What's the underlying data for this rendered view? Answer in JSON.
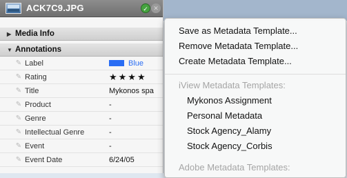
{
  "window": {
    "file_name": "ACK7C9.JPG",
    "thumbnail_icon": "photo-thumbnail"
  },
  "sections": {
    "media_info": "Media Info",
    "annotations": "Annotations"
  },
  "annotations": [
    {
      "field": "Label",
      "value": "Blue",
      "swatch_color": "#2a6df4"
    },
    {
      "field": "Rating",
      "value": "★★★★"
    },
    {
      "field": "Title",
      "value": "Mykonos spa"
    },
    {
      "field": "Product",
      "value": "-"
    },
    {
      "field": "Genre",
      "value": "-"
    },
    {
      "field": "Intellectual Genre",
      "value": "-"
    },
    {
      "field": "Event",
      "value": "-"
    },
    {
      "field": "Event Date",
      "value": "6/24/05"
    }
  ],
  "menu": {
    "save_template": "Save as Metadata Template...",
    "remove_template": "Remove Metadata Template...",
    "create_template": "Create Metadata Template...",
    "iview_header": "iView Metadata Templates:",
    "iview_templates": [
      "Mykonos Assignment",
      "Personal Metadata",
      "Stock Agency_Alamy",
      "Stock Agency_Corbis"
    ],
    "adobe_header": "Adobe Metadata Templates:"
  },
  "colors": {
    "accent_label": "#2a6df4",
    "confirm_button": "#45a33f"
  }
}
